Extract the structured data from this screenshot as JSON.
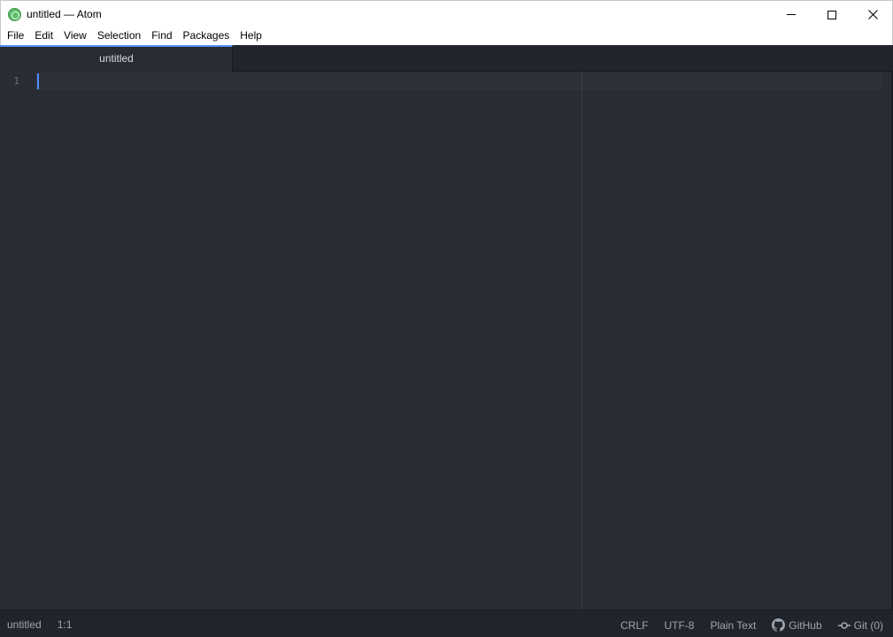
{
  "window": {
    "title": "untitled — Atom"
  },
  "menu": {
    "items": [
      "File",
      "Edit",
      "View",
      "Selection",
      "Find",
      "Packages",
      "Help"
    ]
  },
  "tabs": [
    {
      "label": "untitled",
      "active": true
    }
  ],
  "editor": {
    "line_numbers": [
      "1"
    ]
  },
  "status": {
    "file_name": "untitled",
    "cursor_position": "1:1",
    "line_ending": "CRLF",
    "encoding": "UTF-8",
    "grammar": "Plain Text",
    "github_label": "GitHub",
    "git_label": "Git (0)"
  },
  "colors": {
    "editor_background": "#282c34",
    "tab_accent": "#568af2",
    "cursor": "#528bff"
  }
}
